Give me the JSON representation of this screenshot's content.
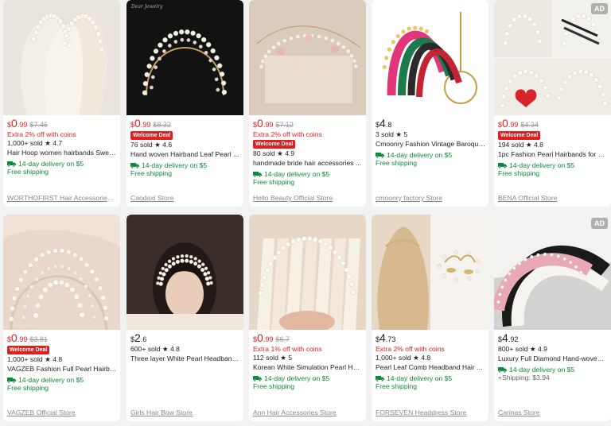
{
  "colors": {
    "sale_red": "#e02020",
    "delivery_green": "#0a8a3a",
    "store_gray": "#888888"
  },
  "icons": {
    "delivery": "truck-icon",
    "rating": "star-icon"
  },
  "products": [
    {
      "price_currency": "$",
      "price_int": "0",
      "price_dec": ".99",
      "original": "$7.46",
      "coins": "Extra 2% off with coins",
      "welcome": "",
      "sold": "1,000+ sold",
      "rating": "4.7",
      "title": "Hair Hoop women hairbands Sweet...",
      "delivery": "14-day delivery on $5",
      "shipping": "Free shipping",
      "store": "WORTHOFIRST Hair Accessories St...",
      "ad": ""
    },
    {
      "price_currency": "$",
      "price_int": "0",
      "price_dec": ".99",
      "original": "$8.32",
      "coins": "",
      "welcome": "Welcome Deal",
      "sold": "76 sold",
      "rating": "4.6",
      "title": "Hand woven Hairband Leaf Pearl ...",
      "delivery": "14-day delivery on $5",
      "shipping": "Free shipping",
      "store": "Caodaxi Store",
      "ad": ""
    },
    {
      "price_currency": "$",
      "price_int": "0",
      "price_dec": ".99",
      "original": "$7.12",
      "coins": "Extra 2% off with coins",
      "welcome": "Welcome Deal",
      "sold": "80 sold",
      "rating": "4.9",
      "title": "handmade bride hair accessories ...",
      "delivery": "14-day delivery on $5",
      "shipping": "Free shipping",
      "store": "Hello Beauty Official Store",
      "ad": ""
    },
    {
      "price_currency": "$",
      "price_int": "4",
      "price_dec": ".8",
      "original": "",
      "coins": "",
      "welcome": "",
      "sold": "3 sold",
      "rating": "5",
      "title": "Cmoonry Fashion Vintage Baroque...",
      "delivery": "14-day delivery on $5",
      "shipping": "Free shipping",
      "store": "cmoonry factory Store",
      "ad": ""
    },
    {
      "price_currency": "$",
      "price_int": "0",
      "price_dec": ".99",
      "original": "$4.34",
      "coins": "",
      "welcome": "Welcome Deal",
      "sold": "194 sold",
      "rating": "4.8",
      "title": "1pc Fashion Pearl Hairbands for W...",
      "delivery": "14-day delivery on $5",
      "shipping": "Free shipping",
      "store": "BENA Official Store",
      "ad": "AD"
    },
    {
      "price_currency": "$",
      "price_int": "0",
      "price_dec": ".99",
      "original": "$3.81",
      "coins": "",
      "welcome": "Welcome Deal",
      "sold": "1,000+ sold",
      "rating": "4.8",
      "title": "VAGZEB Fashion Full Pearl Hairban...",
      "delivery": "14-day delivery on $5",
      "shipping": "Free shipping",
      "store": "VAGZEB Official Store",
      "ad": ""
    },
    {
      "price_currency": "$",
      "price_int": "2",
      "price_dec": ".6",
      "original": "",
      "coins": "",
      "welcome": "",
      "sold": "600+ sold",
      "rating": "4.8",
      "title": "Three layer White Pearl Headband...",
      "delivery": "",
      "shipping": "",
      "store": "Girls Hair Bow Store",
      "ad": ""
    },
    {
      "price_currency": "$",
      "price_int": "0",
      "price_dec": ".99",
      "original": "$6.7",
      "coins": "Extra 1% off with coins",
      "welcome": "",
      "sold": "112 sold",
      "rating": "5",
      "title": "Korean White Simulation Pearl Hai...",
      "delivery": "14-day delivery on $5",
      "shipping": "Free shipping",
      "store": "Ann Hair Accessories Store",
      "ad": ""
    },
    {
      "price_currency": "$",
      "price_int": "4",
      "price_dec": ".73",
      "original": "",
      "coins": "Extra 2% off with coins",
      "welcome": "",
      "sold": "1,000+ sold",
      "rating": "4.8",
      "title": "Pearl Leaf Comb Headband Hair A...",
      "delivery": "14-day delivery on $5",
      "shipping": "Free shipping",
      "store": "FORSEVEN Headdress Store",
      "ad": ""
    },
    {
      "price_currency": "$",
      "price_int": "4",
      "price_dec": ".92",
      "original": "",
      "coins": "",
      "welcome": "",
      "sold": "800+ sold",
      "rating": "4.9",
      "title": "Luxury Full Diamond Hand-woven ...",
      "delivery": "14-day delivery on $5",
      "shipping": "+Shipping: $3.94",
      "store": "Carinas Store",
      "ad": "AD"
    }
  ]
}
